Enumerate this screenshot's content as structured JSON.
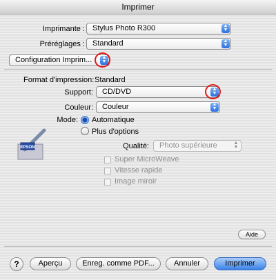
{
  "window": {
    "title": "Imprimer"
  },
  "printer": {
    "label": "Imprimante :",
    "value": "Stylus Photo R300"
  },
  "presets": {
    "label": "Préréglages :",
    "value": "Standard"
  },
  "panel": {
    "value": "Configuration Imprim..."
  },
  "format": {
    "label": "Format d'impression:",
    "value": "Standard"
  },
  "support": {
    "label": "Support:",
    "value": "CD/DVD"
  },
  "color": {
    "label": "Couleur:",
    "value": "Couleur"
  },
  "mode": {
    "label": "Mode:",
    "options": [
      {
        "label": "Automatique",
        "selected": true
      },
      {
        "label": "Plus d'options",
        "selected": false
      }
    ]
  },
  "quality": {
    "label": "Qualité:",
    "value": "Photo supérieure"
  },
  "checkboxes": [
    {
      "label": "Super MicroWeave",
      "checked": false
    },
    {
      "label": "Vitesse rapide",
      "checked": false
    },
    {
      "label": "Image miroir",
      "checked": false
    }
  ],
  "logo": {
    "text": "EPSON"
  },
  "buttons": {
    "help_symbol": "?",
    "aide": "Aide",
    "preview": "Aperçu",
    "save_pdf": "Enreg. comme PDF...",
    "cancel": "Annuler",
    "print": "Imprimer"
  },
  "colors": {
    "accent": "#3b82e8",
    "highlight_ring": "#e01818"
  }
}
